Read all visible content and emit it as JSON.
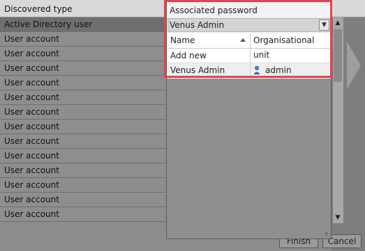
{
  "background": {
    "header": "Discovered type",
    "rows": [
      "Active Directory user",
      "User account",
      "User account",
      "User account",
      "User account",
      "User account",
      "User account",
      "User account",
      "User account",
      "User account",
      "User account",
      "User account",
      "User account",
      "User account"
    ],
    "buttons": {
      "finish": "Finish",
      "cancel": "Cancel"
    }
  },
  "popup": {
    "field_label": "Associated password",
    "selected_value": "Venus Admin",
    "columns": [
      "Name",
      "Organisational unit"
    ],
    "rows": [
      {
        "name": "Add new",
        "ou": ""
      },
      {
        "name": "Venus Admin",
        "ou": "admin",
        "ou_icon": "user-icon"
      }
    ]
  },
  "colors": {
    "highlight": "#e0454e"
  }
}
